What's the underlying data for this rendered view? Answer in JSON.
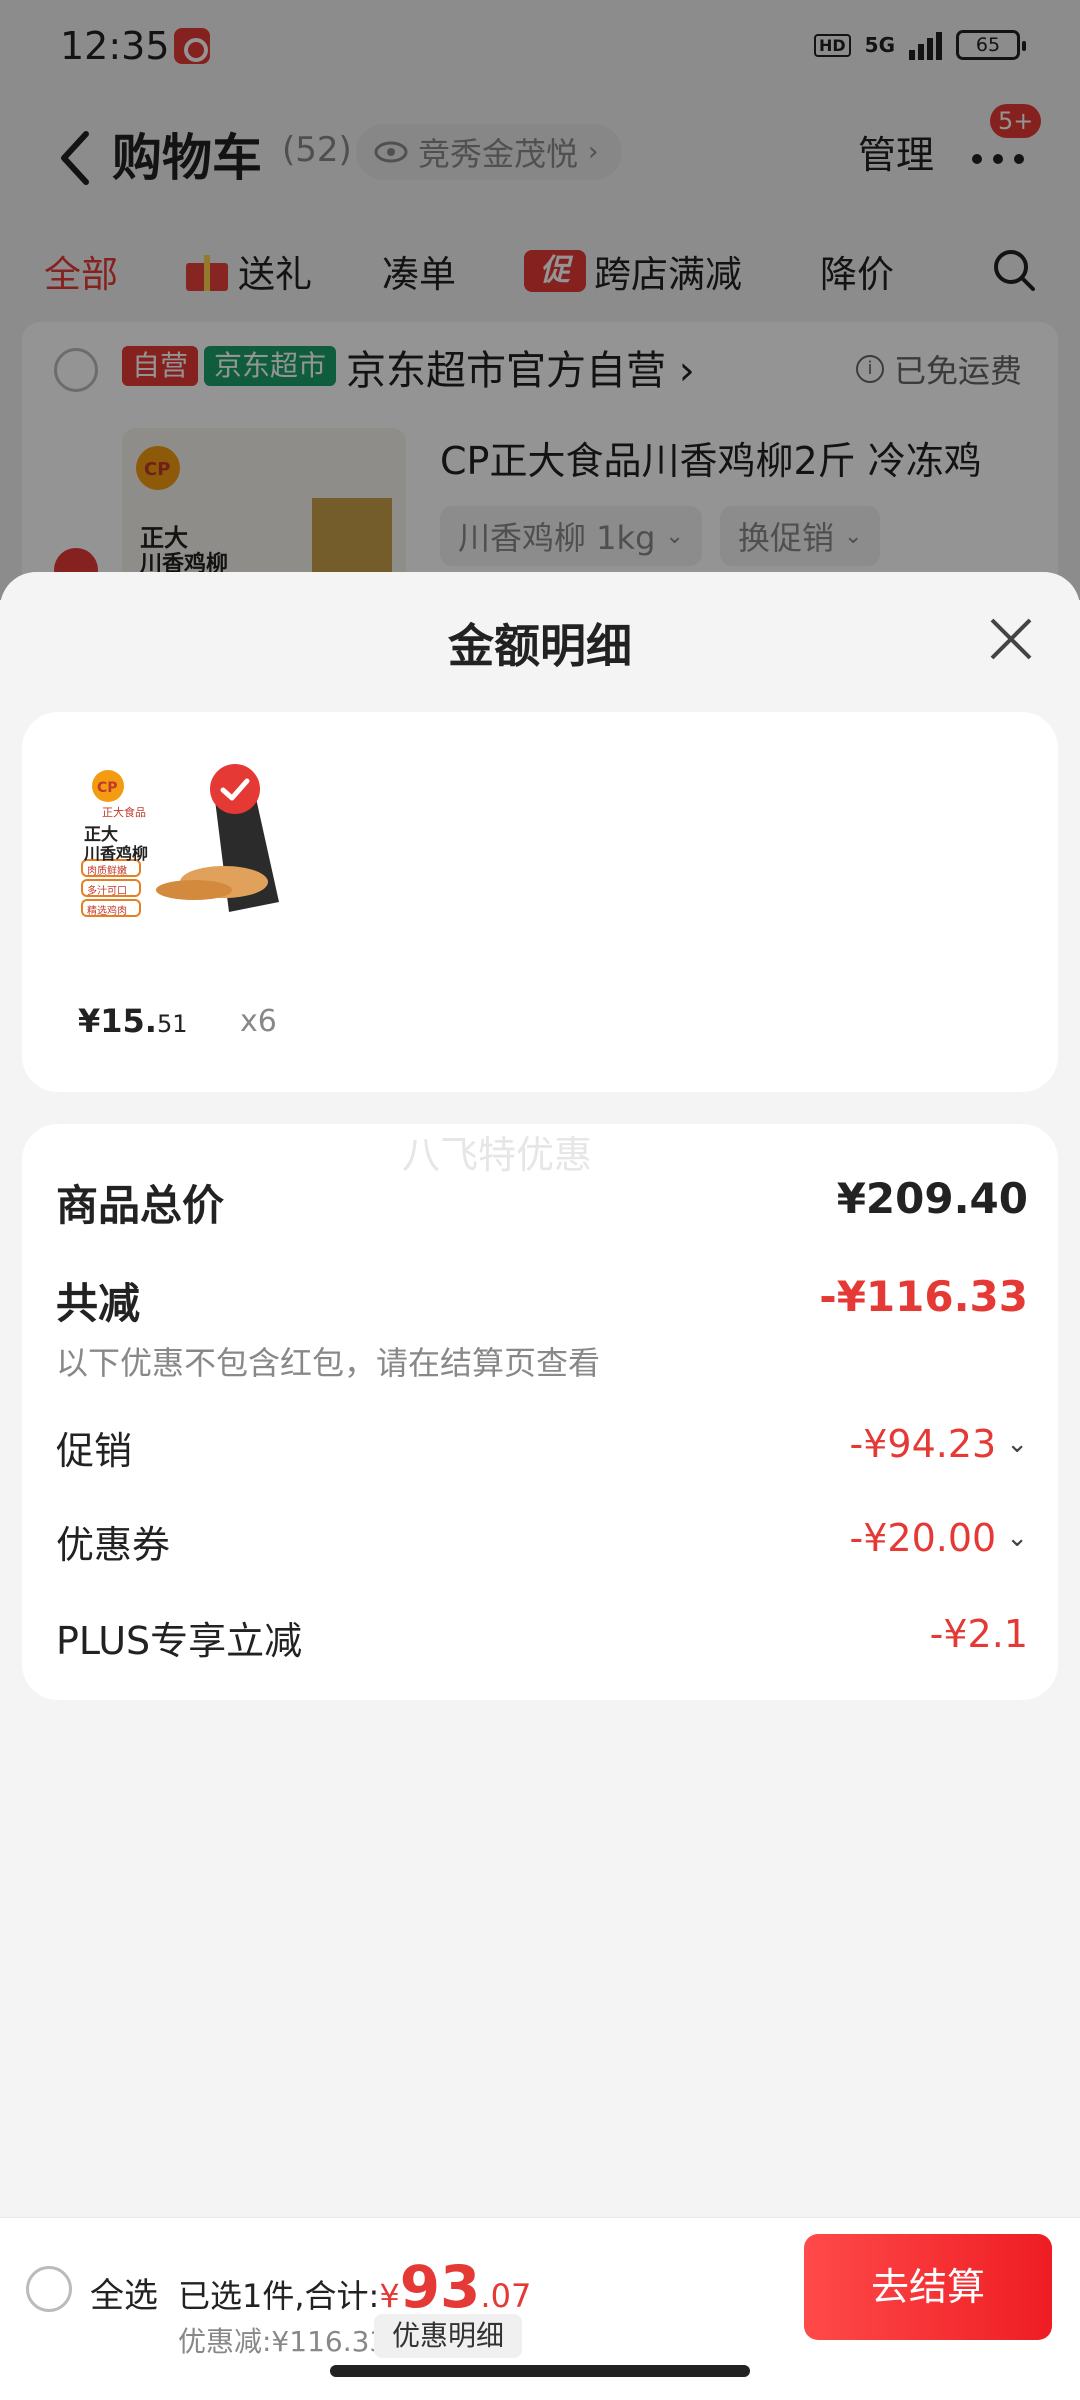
{
  "status": {
    "time": "12:35",
    "network": "5G",
    "hd": "HD",
    "battery": "65"
  },
  "header": {
    "title": "购物车",
    "count": "(52)",
    "store_pill": "竞秀金茂悦",
    "manage": "管理",
    "badge": "5+"
  },
  "tabs": [
    {
      "label": "全部",
      "active": true
    },
    {
      "label": "送礼",
      "icon": "gift-icon"
    },
    {
      "label": "凑单"
    },
    {
      "label": "跨店满减",
      "icon_text": "促"
    },
    {
      "label": "降价"
    }
  ],
  "cart": {
    "tag_self": "自营",
    "tag_market": "京东超市",
    "store_name": "京东超市官方自营",
    "free_shipping": "已免运费",
    "product_title": "CP正大食品川香鸡柳2斤  冷冻鸡",
    "spec": "川香鸡柳 1kg",
    "promo_switch": "换促销",
    "thumb_brand": "CP",
    "thumb_sub": "正大食品",
    "thumb_name1": "正大",
    "thumb_name2": "川香鸡柳"
  },
  "sheet": {
    "title": "金额明细",
    "item": {
      "brand": "CP",
      "brand_sub": "正大食品",
      "name1": "正大",
      "name2": "川香鸡柳",
      "tags": [
        "肉质鲜嫩",
        "多汁可口",
        "精选鸡肉"
      ],
      "price_int": "¥15.",
      "price_dec": "51",
      "qty": "x6"
    },
    "watermark": "八飞特优惠",
    "rows": {
      "total_label": "商品总价",
      "total_value": "¥209.40",
      "reduce_label": "共减",
      "reduce_value": "-¥116.33",
      "note": "以下优惠不包含红包，请在结算页查看",
      "promo_label": "促销",
      "promo_value": "-¥94.23",
      "coupon_label": "优惠券",
      "coupon_value": "-¥20.00",
      "plus_label": "PLUS专享立减",
      "plus_value": "-¥2.1"
    }
  },
  "bottom": {
    "select_all": "全选",
    "selected_text": "已选1件,合计:",
    "yen": "¥",
    "sum_int": "93",
    "sum_dec": ".07",
    "discount": "优惠减:¥116.33",
    "detail_btn": "优惠明细",
    "checkout": "去结算"
  },
  "colors": {
    "accent": "#e53935",
    "green": "#1aa06a"
  }
}
